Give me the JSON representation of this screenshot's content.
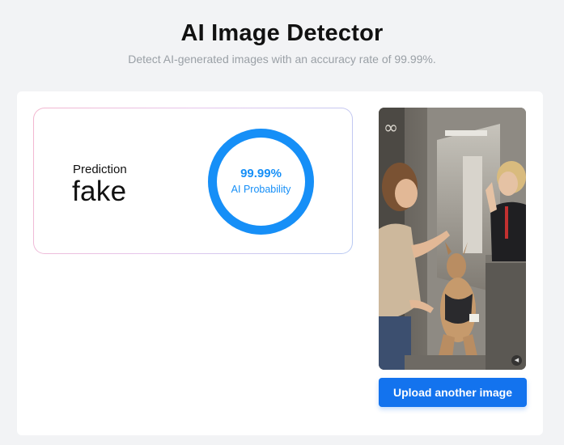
{
  "header": {
    "title": "AI Image Detector",
    "subtitle": "Detect AI-generated images with an accuracy rate of 99.99%."
  },
  "result": {
    "prediction_label": "Prediction",
    "prediction_value": "fake",
    "probability_text": "99.99%",
    "probability_fraction": 0.9999,
    "probability_caption": "AI Probability"
  },
  "image": {
    "mute_icon": "speaker-muted-icon"
  },
  "actions": {
    "upload_label": "Upload another image"
  },
  "colors": {
    "accent": "#168ff7",
    "button": "#1373ee",
    "ring_track": "#e6eef8"
  }
}
